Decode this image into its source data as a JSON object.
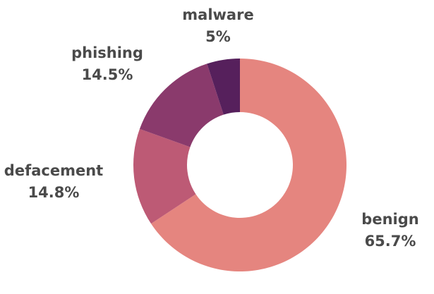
{
  "chart_data": {
    "type": "pie",
    "style": "donut",
    "slices": [
      {
        "label": "benign",
        "value": 65.7,
        "display": "65.7%",
        "color": "#e5857f"
      },
      {
        "label": "defacement",
        "value": 14.8,
        "display": "14.8%",
        "color": "#bd5a75"
      },
      {
        "label": "phishing",
        "value": 14.5,
        "display": "14.5%",
        "color": "#8a3a6c"
      },
      {
        "label": "malware",
        "value": 5,
        "display": "5%",
        "color": "#56205c"
      }
    ],
    "start": "top",
    "direction": "clockwise"
  }
}
